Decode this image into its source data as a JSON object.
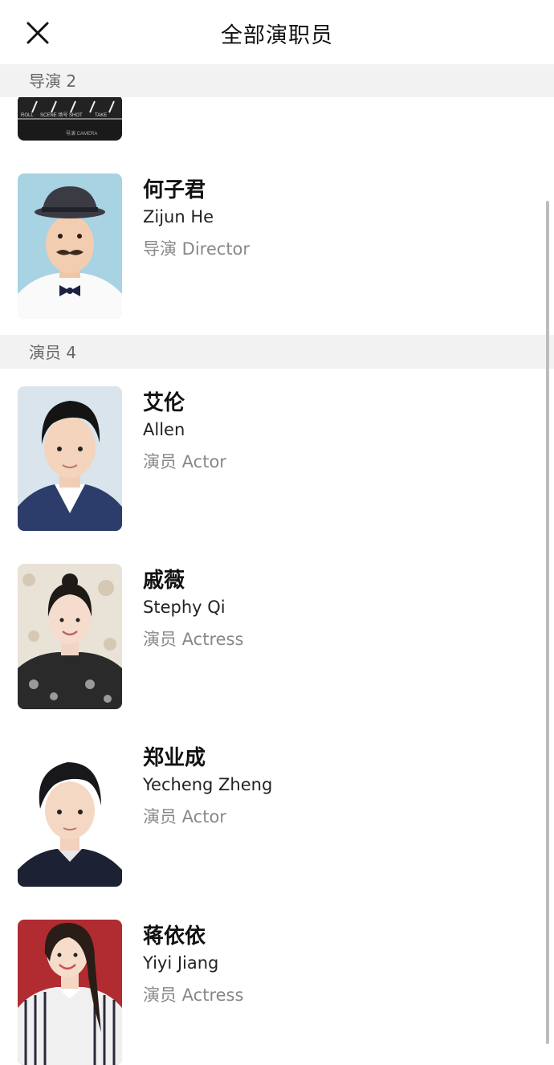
{
  "header": {
    "title": "全部演职员"
  },
  "sections": {
    "directors": {
      "label": "导演 2"
    },
    "actors": {
      "label": "演员 4"
    }
  },
  "clapper_text": {
    "roll": "ROLL",
    "scene": "SCENE 场号",
    "shot": "SHOT",
    "take": "TAKE",
    "misc": "导演 CAMERA"
  },
  "people": [
    {
      "name": "何子君",
      "english": "Zijun He",
      "role": "导演 Director"
    },
    {
      "name": "艾伦",
      "english": "Allen",
      "role": "演员 Actor"
    },
    {
      "name": "戚薇",
      "english": "Stephy Qi",
      "role": "演员 Actress"
    },
    {
      "name": "郑业成",
      "english": "Yecheng Zheng",
      "role": "演员 Actor"
    },
    {
      "name": "蒋依依",
      "english": "Yiyi Jiang",
      "role": "演员 Actress"
    }
  ],
  "colors": {
    "section_bg": "#f2f2f2",
    "secondary_text": "#888888"
  }
}
